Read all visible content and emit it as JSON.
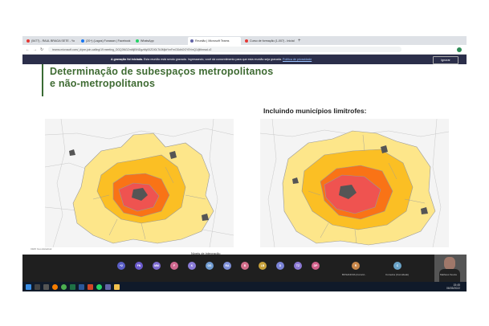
{
  "browser": {
    "tabs": [
      {
        "label": "(5477) - RAUL BRAGA SETE - Yo",
        "color": "#e53935"
      },
      {
        "label": "(20+) (Lagos) Funasan | Facebook",
        "color": "#1877f2"
      },
      {
        "label": "WhatsApp",
        "color": "#25d366"
      },
      {
        "label": "Reunião | Microsoft Teams",
        "color": "#6264a7"
      },
      {
        "label": "Curso de formação (1-007) - Inicial",
        "color": "#e53935"
      }
    ],
    "new_tab": "+",
    "url": "teams.microsoft.com/_#/pre-join-calling/19:meeting_OGQ3NGZmMjEtNDgzMy00ZDI0LTk3MjktYmFmODdhOGY5YmQ1@thread.v2"
  },
  "banner": {
    "title": "A gravação foi iniciada.",
    "text": "Esta reunião está sendo gravada. Ingressando, você dá consentimento para que esta reunião seja gravada.",
    "link": "Política de privacidade",
    "button": "Ignorar"
  },
  "slide": {
    "title_line1": "Determinação de subespaços metropolitanos",
    "title_line2": "e não-metropolitanos",
    "subtitle": "Incluindo municípios limítrofes:",
    "credit": "CEDI Geo-Estadual",
    "caption": "Níveis de integração"
  },
  "meeting": {
    "timer": "1:54",
    "participants": [
      {
        "initials": "+2",
        "color": "#5b5fc7"
      },
      {
        "initials": "FN",
        "color": "#6a5acd"
      },
      {
        "initials": "MM",
        "color": "#7d6bd0"
      },
      {
        "initials": "F",
        "color": "#d0688f"
      },
      {
        "initials": "K",
        "color": "#8a7bd8"
      },
      {
        "initials": "OS",
        "color": "#6f9bd1"
      },
      {
        "initials": "RA",
        "color": "#7e8fd8"
      },
      {
        "initials": "B",
        "color": "#d36e8a"
      },
      {
        "initials": "LB",
        "color": "#c7a13a"
      },
      {
        "initials": "D",
        "color": "#7a83d6"
      },
      {
        "initials": "TZ",
        "color": "#8b78d4"
      },
      {
        "initials": "DP",
        "color": "#d2608a"
      },
      {
        "initials": "R",
        "color": "#c8874a"
      },
      {
        "initials": "C",
        "color": "#6aa3c8"
      }
    ],
    "named": [
      {
        "name": "BOSANOVA (Convid..."
      },
      {
        "name": "Cumeina (Convidado)"
      },
      {
        "name": "Matheus Souza"
      }
    ]
  },
  "taskbar": {
    "time": "15:45",
    "date": "06/05/2022"
  }
}
